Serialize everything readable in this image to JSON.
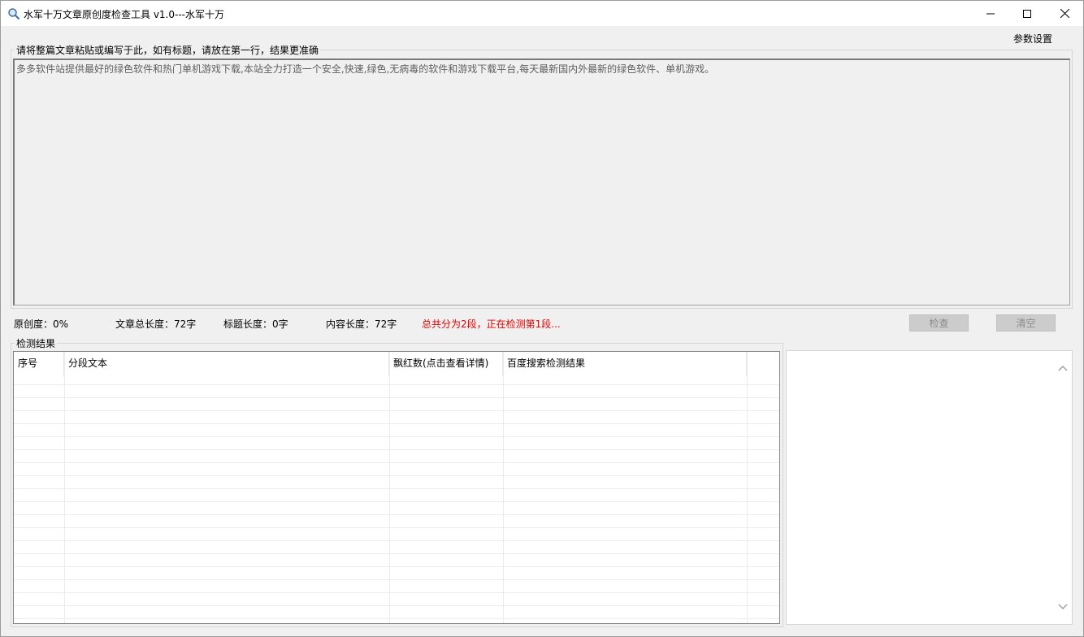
{
  "window": {
    "title": "水军十万文章原创度检查工具  v1.0---水军十万",
    "icons": {
      "app": "magnifier-icon",
      "minimize": "minimize-icon",
      "maximize": "maximize-icon",
      "close": "close-icon"
    }
  },
  "menu": {
    "settings_label": "参数设置"
  },
  "input_section": {
    "label": "请将整篇文章粘贴或编写于此，如有标题，请放在第一行，结果更准确",
    "article_text": "多多软件站提供最好的绿色软件和热门单机游戏下载,本站全力打造一个安全,快速,绿色,无病毒的软件和游戏下载平台,每天最新国内外最新的绿色软件、单机游戏。"
  },
  "stats": {
    "originality": "原创度：0%",
    "total_length": "文章总长度：72字",
    "title_length": "标题长度：0字",
    "content_length": "内容长度：72字",
    "status": "总共分为2段，正在检测第1段...",
    "status_color": "#e00000"
  },
  "buttons": {
    "check_label": "检查",
    "clear_label": "清空"
  },
  "results": {
    "label": "检测结果",
    "columns": [
      "序号",
      "分段文本",
      "飘红数(点击查看详情)",
      "百度搜索检测结果"
    ],
    "rows": []
  },
  "side_panel": {
    "scroll_up_icon": "chevron-up-icon",
    "scroll_down_icon": "chevron-down-icon"
  }
}
